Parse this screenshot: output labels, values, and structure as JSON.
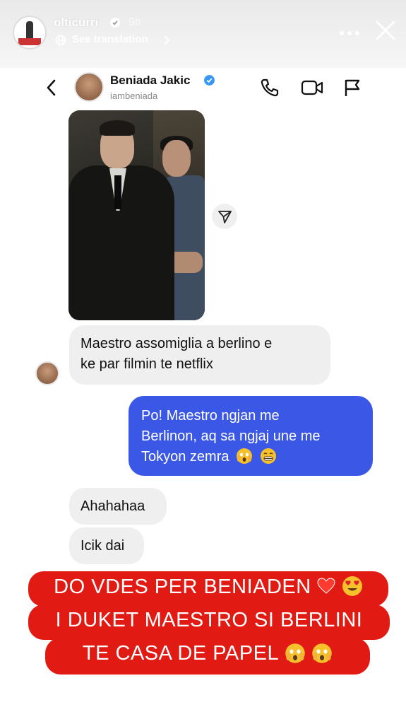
{
  "story": {
    "username": "olticurri",
    "time": "9h",
    "see_translation": "See translation"
  },
  "dm": {
    "name": "Beniada Jakic",
    "handle": "iambeniada"
  },
  "messages": [
    {
      "from": "them",
      "text_line1": "Maestro assomiglia a berlino e",
      "text_line2": "ke par filmin te netflix"
    },
    {
      "from": "me",
      "text_line1": "Po! Maestro ngjan me",
      "text_line2": "Berlinon, aq sa ngjaj une me",
      "text_line3": "Tokyon zemra"
    },
    {
      "from": "them",
      "text": "Ahahahaa"
    },
    {
      "from": "them",
      "text": "Icik dai"
    }
  ],
  "caption": {
    "line1": "DO VDES PER BENIADEN",
    "line2": "I DUKET MAESTRO SI BERLINI",
    "line3": "TE CASA DE PAPEL"
  },
  "icons": [
    "more-icon",
    "close-icon",
    "back-icon",
    "call-icon",
    "video-icon",
    "flag-icon",
    "share-icon",
    "heart-icon",
    "emoji-icon"
  ],
  "colors": {
    "outgoing_bubble": "#3b57e6",
    "incoming_bubble": "#efefef",
    "caption_bg": "#e11b14",
    "verified": "#3897f0"
  }
}
